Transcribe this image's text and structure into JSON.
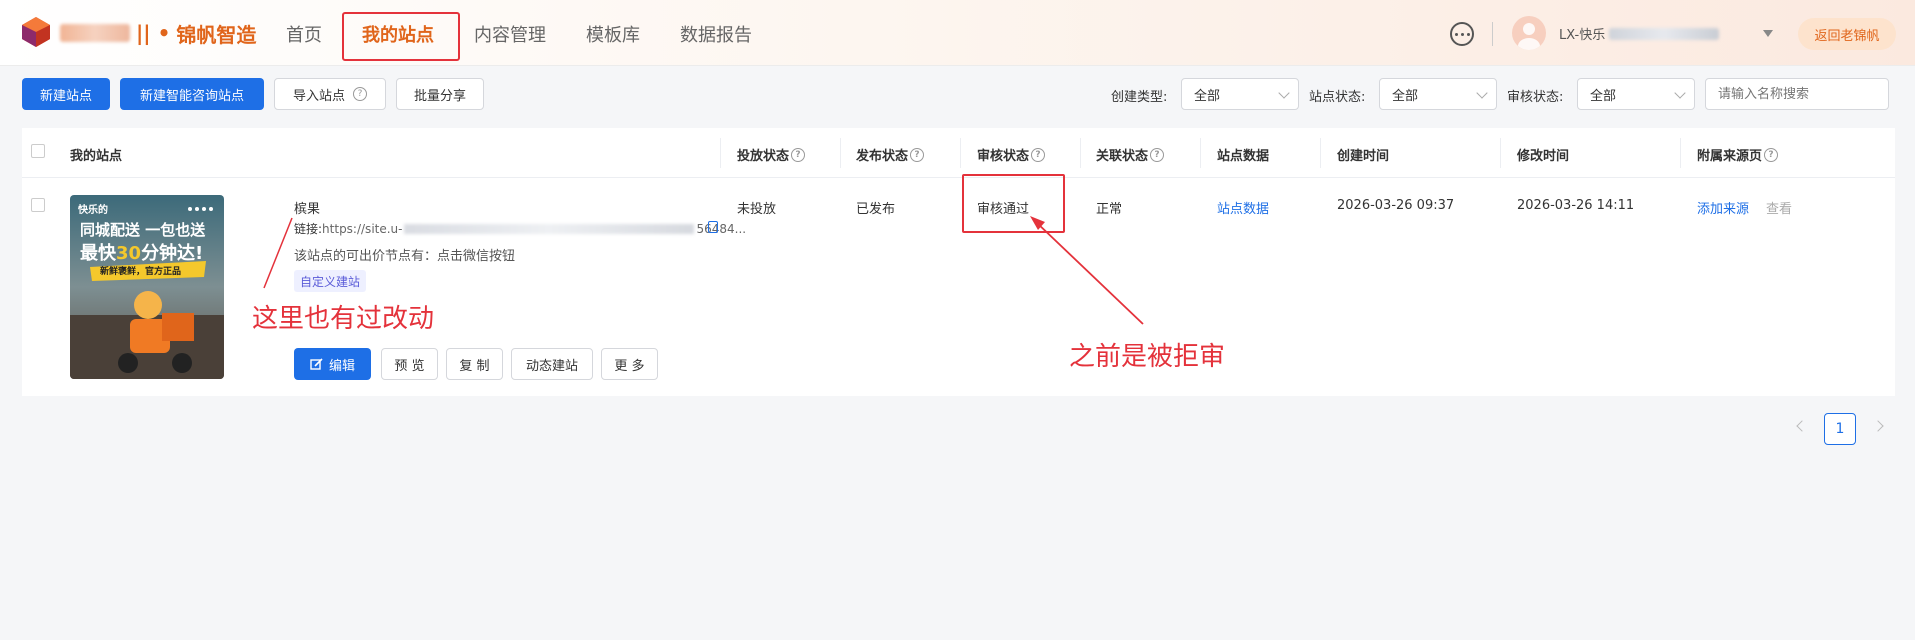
{
  "header": {
    "brand": "锦帆智造",
    "brand_separator": "|| •",
    "nav": [
      {
        "label": "首页",
        "active": false
      },
      {
        "label": "我的站点",
        "active": true
      },
      {
        "label": "内容管理",
        "active": false
      },
      {
        "label": "模板库",
        "active": false
      },
      {
        "label": "数据报告",
        "active": false
      }
    ],
    "user_name": "LX-快乐",
    "back_button": "返回老锦帆",
    "accent_color": "#e0651b"
  },
  "toolbar": {
    "new_site": "新建站点",
    "new_smart_site": "新建智能咨询站点",
    "import_site": "导入站点",
    "batch_share": "批量分享",
    "filters": [
      {
        "label": "创建类型:",
        "value": "全部"
      },
      {
        "label": "站点状态:",
        "value": "全部"
      },
      {
        "label": "审核状态:",
        "value": "全部"
      }
    ],
    "search_placeholder": "请输入名称搜索"
  },
  "table": {
    "columns": [
      "我的站点",
      "投放状态",
      "发布状态",
      "审核状态",
      "关联状态",
      "站点数据",
      "创建时间",
      "修改时间",
      "附属来源页"
    ],
    "row": {
      "name": "槟果",
      "link_label": "链接:",
      "link_prefix": "https://site.u-",
      "link_suffix": "56484...",
      "price_note": "该站点的可出价节点有：点击微信按钮",
      "tag": "自定义建站",
      "thumb_brand": "快乐的",
      "thumb_line1": "同城配送 一包也送",
      "thumb_line2a": "最快",
      "thumb_line2b": "30",
      "thumb_line2c": "分钟达!",
      "thumb_line3": "新鲜褒鲜，官方正品",
      "delivery_status": "未投放",
      "publish_status": "已发布",
      "review_status": "审核通过",
      "link_status": "正常",
      "site_data": "站点数据",
      "created": "2026-03-26 09:37",
      "modified": "2026-03-26 14:11",
      "add_source": "添加来源",
      "view": "查看",
      "actions": {
        "edit": "编辑",
        "preview": "预 览",
        "copy": "复 制",
        "dynamic": "动态建站",
        "more": "更 多"
      }
    }
  },
  "annotations": {
    "left_note": "这里也有过改动",
    "right_note": "之前是被拒审",
    "color": "#e4323b"
  },
  "pagination": {
    "current": "1"
  }
}
